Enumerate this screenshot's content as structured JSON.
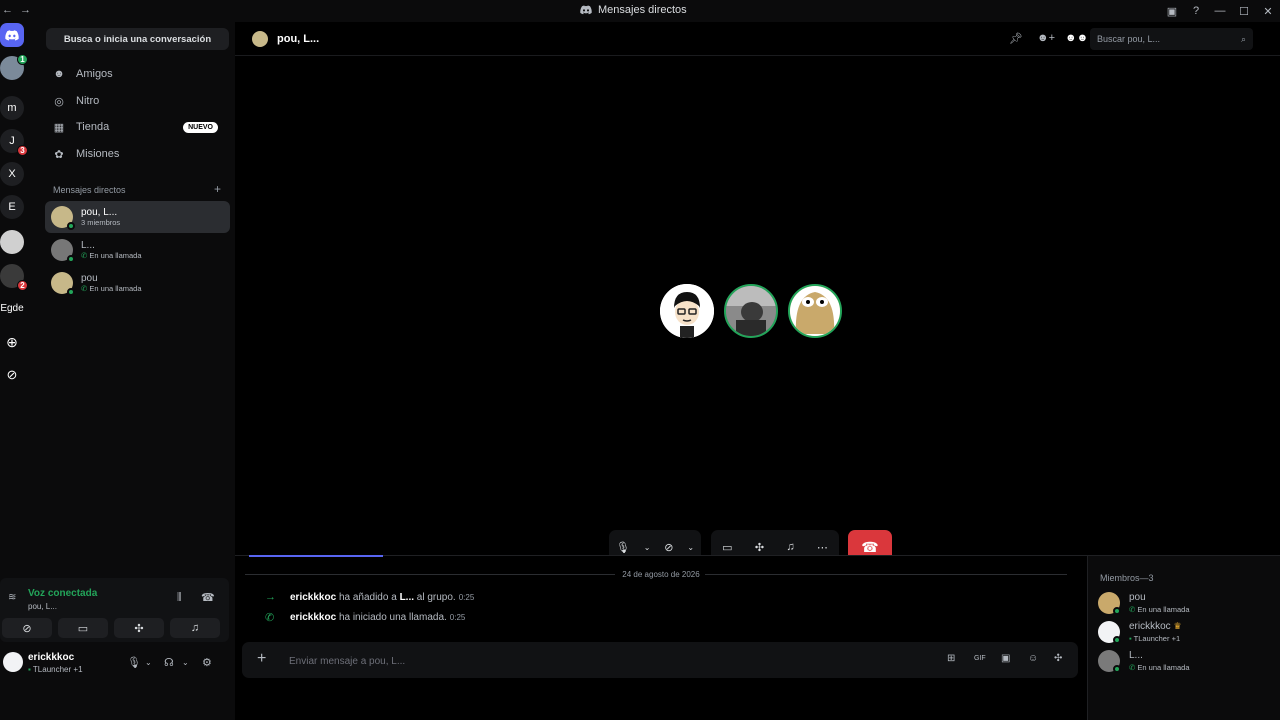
{
  "window": {
    "title": "Mensajes directos",
    "controls": [
      "inbox-icon",
      "help-icon",
      "minimize-icon",
      "maximize-icon",
      "close-icon"
    ]
  },
  "rail": {
    "items": [
      {
        "label": "m"
      },
      {
        "label": "J",
        "badge": "3"
      },
      {
        "label": "X"
      },
      {
        "label": "E"
      },
      {
        "label": "Egde"
      }
    ],
    "badges": {
      "avatar_top": "1",
      "avatar_bottom": "2"
    }
  },
  "sidebar": {
    "search_label": "Busca o inicia una conversación",
    "nav": [
      {
        "label": "Amigos",
        "icon": "friends-icon"
      },
      {
        "label": "Nitro",
        "icon": "nitro-icon"
      },
      {
        "label": "Tienda",
        "icon": "shop-icon",
        "badge": "NUEVO"
      },
      {
        "label": "Misiones",
        "icon": "quests-icon"
      }
    ],
    "dm_section_title": "Mensajes directos",
    "dms": [
      {
        "name": "pou, L...",
        "sub": "3 miembros",
        "active": true
      },
      {
        "name": "L...",
        "sub": "En una llamada"
      },
      {
        "name": "pou",
        "sub": "En una llamada"
      }
    ]
  },
  "voice_panel": {
    "status": "Voz conectada",
    "channel": "pou, L..."
  },
  "user_panel": {
    "name": "erickkkoc",
    "activity": "TLauncher",
    "extra": "+1"
  },
  "header": {
    "title": "pou, L...",
    "search_placeholder": "Buscar pou, L..."
  },
  "chat": {
    "date": "24 de agosto de 2026",
    "messages": [
      {
        "user": "erickkkoc",
        "text": "ha añadido a",
        "target": "L...",
        "text2": "al grupo.",
        "time": "0:25"
      },
      {
        "user": "erickkkoc",
        "text": "ha iniciado una llamada.",
        "time": "0:25"
      }
    ],
    "placeholder": "Enviar mensaje a pou, L..."
  },
  "members": {
    "title": "Miembros—3",
    "list": [
      {
        "name": "pou",
        "sub": "En una llamada"
      },
      {
        "name": "erickkkoc",
        "sub": "TLauncher",
        "extra": "+1"
      },
      {
        "name": "L...",
        "sub": "En una llamada"
      }
    ]
  },
  "colors": {
    "green": "#23a55a",
    "red": "#da373c",
    "accent": "#5865f2"
  }
}
